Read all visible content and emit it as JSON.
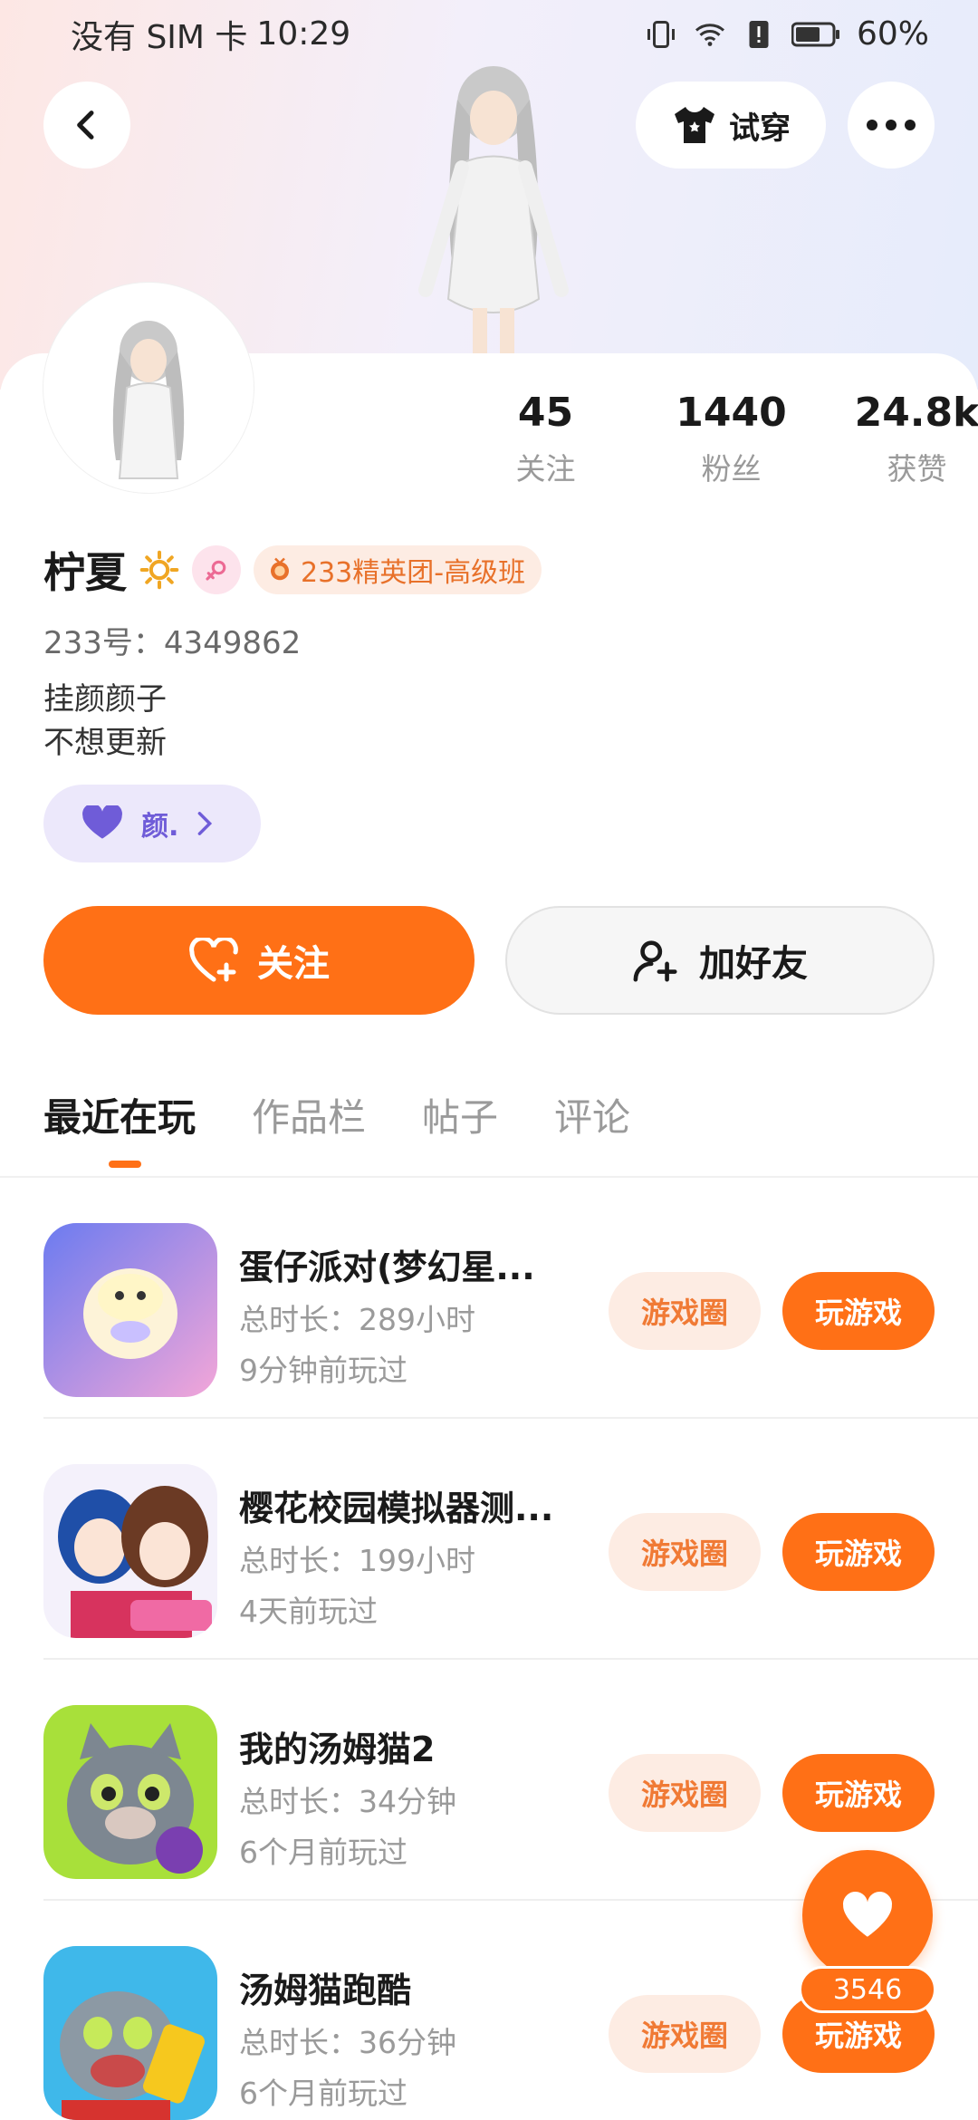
{
  "status_bar": {
    "carrier": "没有 SIM 卡",
    "time": "10:29",
    "battery": "60%"
  },
  "header": {
    "tryon_label": "试穿"
  },
  "profile": {
    "following_count": "45",
    "following_label": "关注",
    "followers_count": "1440",
    "followers_label": "粉丝",
    "likes_count": "24.8k",
    "likes_label": "获赞",
    "name": "柠夏",
    "class_badge": "233精英团-高级班",
    "account_id": "233号：4349862",
    "bio_line1": "挂颜颜子",
    "bio_line2": "不想更新",
    "tag_label": "颜."
  },
  "actions": {
    "follow_label": "关注",
    "add_friend_label": "加好友"
  },
  "tabs": [
    {
      "label": "最近在玩",
      "active": true
    },
    {
      "label": "作品栏",
      "active": false
    },
    {
      "label": "帖子",
      "active": false
    },
    {
      "label": "评论",
      "active": false
    }
  ],
  "games": [
    {
      "title": "蛋仔派对(梦幻星...",
      "duration": "总时长：289小时",
      "last_played": "9分钟前玩过",
      "circle_label": "游戏圈",
      "play_label": "玩游戏"
    },
    {
      "title": "樱花校园模拟器测...",
      "duration": "总时长：199小时",
      "last_played": "4天前玩过",
      "circle_label": "游戏圈",
      "play_label": "玩游戏"
    },
    {
      "title": "我的汤姆猫2",
      "duration": "总时长：34分钟",
      "last_played": "6个月前玩过",
      "circle_label": "游戏圈",
      "play_label": "玩游戏"
    },
    {
      "title": "汤姆猫跑酷",
      "duration": "总时长：36分钟",
      "last_played": "6个月前玩过",
      "circle_label": "游戏圈",
      "play_label": "玩游戏"
    }
  ],
  "floating_like": {
    "count": "3546"
  },
  "colors": {
    "accent": "#ff7016",
    "tag_purple": "#6f5cd8"
  }
}
